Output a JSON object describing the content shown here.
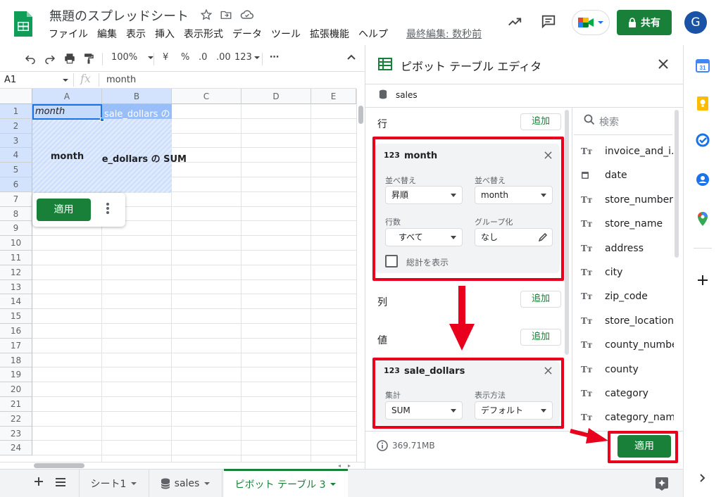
{
  "app": {
    "title": "無題のスプレッドシート",
    "menu": [
      "ファイル",
      "編集",
      "表示",
      "挿入",
      "表示形式",
      "データ",
      "ツール",
      "拡張機能",
      "ヘルプ"
    ],
    "last_edit": "最終編集: 数秒前",
    "share_label": "共有",
    "avatar_letter": "G"
  },
  "toolbar": {
    "zoom": "100%",
    "currency": "¥",
    "percent": "%",
    "dec_decrease": ".0",
    "dec_increase": ".00",
    "format_123": "123",
    "more": "⋯"
  },
  "formula": {
    "cell_ref": "A1",
    "fx": "fx",
    "value": "month"
  },
  "grid": {
    "columns": [
      "A",
      "B",
      "C",
      "D",
      "E"
    ],
    "rows": [
      "1",
      "2",
      "3",
      "4",
      "5",
      "6",
      "7",
      "8",
      "9",
      "10",
      "11",
      "12",
      "13",
      "14",
      "15",
      "16",
      "17",
      "18",
      "19",
      "20",
      "21",
      "22",
      "23",
      "24"
    ],
    "a1": "month",
    "b1": "sale_dollars の SUM",
    "pivot_row_label": "month",
    "pivot_value_label": "sale_dollars の SUM",
    "apply_label": "適用"
  },
  "sheets": {
    "tabs": [
      "シート1",
      "sales",
      "ピボット テーブル 3"
    ]
  },
  "panel": {
    "title": "ピボット テーブル エディタ",
    "source": "sales",
    "rows_label": "行",
    "columns_label": "列",
    "values_label": "値",
    "add_label": "追加",
    "row_card": {
      "field": "month",
      "sort_label": "並べ替え",
      "sort_value": "昇順",
      "sortby_label": "並べ替え",
      "sortby_value": "month",
      "rows_count_label": "行数",
      "rows_count_value": "すべて",
      "group_label": "グループ化",
      "group_value": "なし",
      "totals_label": "総計を表示"
    },
    "value_card": {
      "field": "sale_dollars",
      "agg_label": "集計",
      "agg_value": "SUM",
      "display_label": "表示方法",
      "display_value": "デフォルト"
    },
    "memory": "369.71MB",
    "apply_label": "適用",
    "search_placeholder": "検索",
    "fields": [
      {
        "icon": "text",
        "name": "invoice_and_i..."
      },
      {
        "icon": "date",
        "name": "date"
      },
      {
        "icon": "text",
        "name": "store_number"
      },
      {
        "icon": "text",
        "name": "store_name"
      },
      {
        "icon": "text",
        "name": "address"
      },
      {
        "icon": "text",
        "name": "city"
      },
      {
        "icon": "text",
        "name": "zip_code"
      },
      {
        "icon": "text",
        "name": "store_location"
      },
      {
        "icon": "text",
        "name": "county_number"
      },
      {
        "icon": "text",
        "name": "county"
      },
      {
        "icon": "text",
        "name": "category"
      },
      {
        "icon": "text",
        "name": "category_name"
      }
    ],
    "field_type_glyph": "Tт",
    "num_glyph": "123"
  },
  "colors": {
    "green": "#188038",
    "red": "#e8001c",
    "selection": "#c6dafc"
  }
}
